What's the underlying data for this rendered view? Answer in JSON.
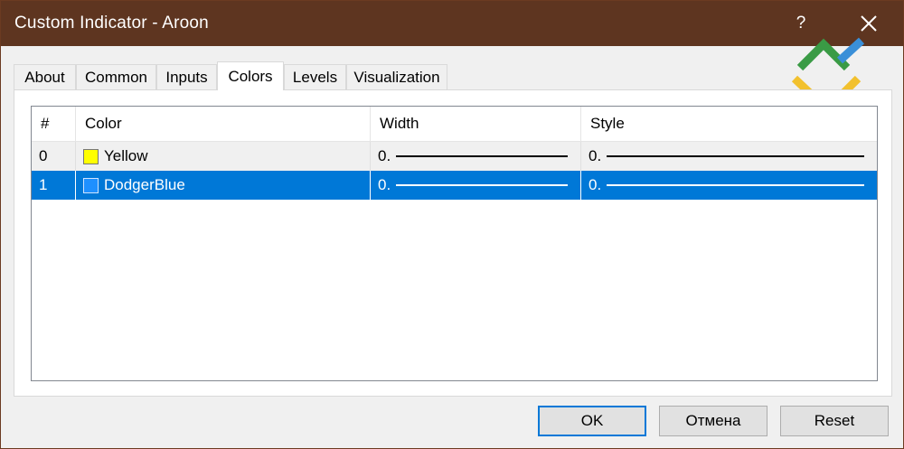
{
  "window": {
    "title": "Custom Indicator - Aroon",
    "help_glyph": "?"
  },
  "tabs": [
    {
      "label": "About"
    },
    {
      "label": "Common"
    },
    {
      "label": "Inputs"
    },
    {
      "label": "Colors",
      "active": true
    },
    {
      "label": "Levels"
    },
    {
      "label": "Visualization"
    }
  ],
  "table": {
    "columns": [
      "#",
      "Color",
      "Width",
      "Style"
    ],
    "rows": [
      {
        "index": "0",
        "color_name": "Yellow",
        "swatch": "#ffff00",
        "width": "0.",
        "style": "0.",
        "selected": false
      },
      {
        "index": "1",
        "color_name": "DodgerBlue",
        "swatch": "#1e90ff",
        "width": "0.",
        "style": "0.",
        "selected": true
      }
    ]
  },
  "buttons": {
    "ok": "OK",
    "cancel": "Отмена",
    "reset": "Reset"
  },
  "colors": {
    "titlebar": "#5e3520",
    "selection": "#0078d7",
    "logo_green": "#3a9b45",
    "logo_yellow": "#f2c12e",
    "logo_blue": "#3a8fd8"
  }
}
